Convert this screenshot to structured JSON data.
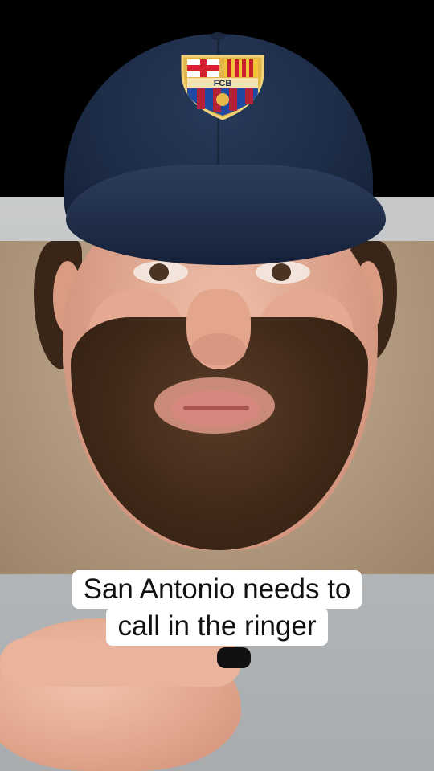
{
  "caption": {
    "line1": "San Antonio needs to",
    "line2": "call in the ringer"
  },
  "cap_crest": {
    "text": "FCB",
    "icon": "fc-barcelona-crest-icon"
  },
  "colors": {
    "cap": "#1d2c47",
    "shirt": "#b29a80",
    "caption_background": "#ffffff",
    "caption_text": "#111111"
  }
}
